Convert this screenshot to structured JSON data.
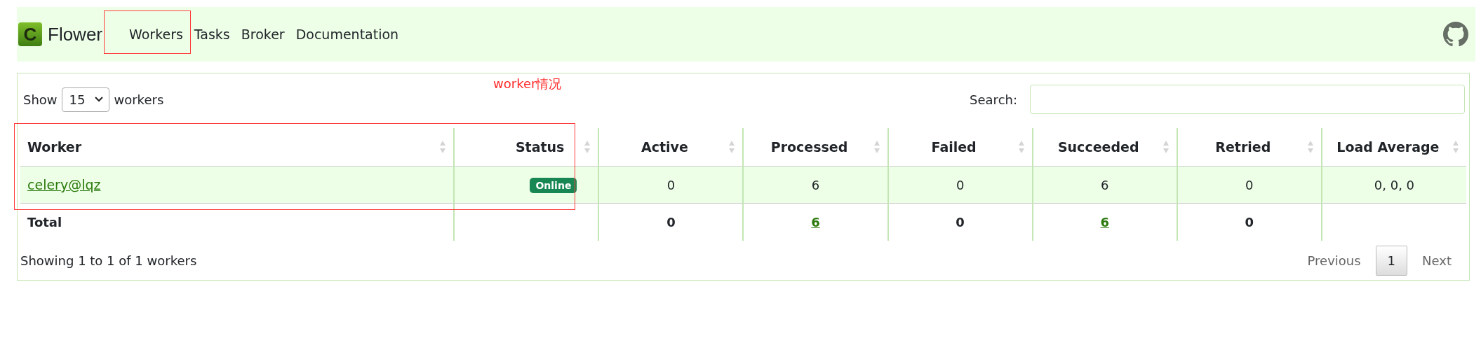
{
  "navbar": {
    "brand": "Flower",
    "logo_letter": "C",
    "items": [
      {
        "label": "Workers"
      },
      {
        "label": "Tasks"
      },
      {
        "label": "Broker"
      },
      {
        "label": "Documentation"
      }
    ]
  },
  "annotations": {
    "note": "worker情况"
  },
  "length_control": {
    "prefix": "Show",
    "value": "15",
    "suffix": "workers"
  },
  "search": {
    "label": "Search:"
  },
  "table": {
    "columns": [
      {
        "label": "Worker"
      },
      {
        "label": "Status"
      },
      {
        "label": "Active"
      },
      {
        "label": "Processed"
      },
      {
        "label": "Failed"
      },
      {
        "label": "Succeeded"
      },
      {
        "label": "Retried"
      },
      {
        "label": "Load Average"
      }
    ],
    "rows": [
      {
        "worker": "celery@lqz",
        "status": {
          "label": "Online",
          "kind": "online"
        },
        "values": [
          "0",
          "6",
          "0",
          "6",
          "0",
          "0, 0, 0"
        ]
      }
    ],
    "total": {
      "label": "Total",
      "cells": [
        {
          "text": ""
        },
        {
          "text": "0",
          "link": false
        },
        {
          "text": "6",
          "link": true
        },
        {
          "text": "0",
          "link": false
        },
        {
          "text": "6",
          "link": true
        },
        {
          "text": "0",
          "link": false
        },
        {
          "text": ""
        }
      ]
    }
  },
  "info": "Showing 1 to 1 of 1 workers",
  "pagination": {
    "previous": {
      "label": "Previous",
      "disabled": true
    },
    "pages": [
      {
        "label": "1",
        "selected": true
      }
    ],
    "next": {
      "label": "Next",
      "disabled": true
    }
  }
}
